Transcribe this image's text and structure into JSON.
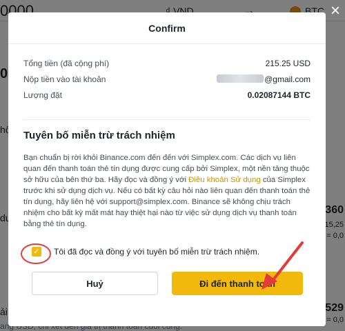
{
  "background": {
    "amount": "0000",
    "fiat_currency": "VND",
    "crypto_currency": "BTC",
    "arrow": "→",
    "left_fragments": [
      "0",
      "hô",
      "du",
      "ải"
    ],
    "right_fragments": [
      "360",
      "215,25",
      "0 = 0,0",
      "529",
      "0 = 0,0"
    ],
    "footer_text": "ang USD, chỉ xét đến giá trị thanh toán cuối cùng."
  },
  "modal": {
    "title": "Confirm",
    "close_icon": "×",
    "info_rows": [
      {
        "label": "Tổng tiền (đã cộng phí)",
        "value": "215.25 USD"
      },
      {
        "label": "Nộp tiền vào tài khoản",
        "value": "@gmail.com"
      },
      {
        "label": "Lượng đặt",
        "value": "0.02087144 BTC"
      }
    ],
    "disclaimer": {
      "title": "Tuyên bố miễn trừ trách nhiệm",
      "text_before_link": "Bạn chuẩn bị rời khỏi Binance.com đến đến với Simplex.com. Các dịch vụ liên quan đến thanh toán thẻ tín dụng được cung cấp bởi Simplex, một nền tảng thuộc sở hữu của bên thứ ba. Hãy đọc và đồng ý với ",
      "link_text": "Điều khoản Sử dụng",
      "text_after_link": " của Simplex trước khi sử dụng dịch vụ. Nếu có bất kỳ câu hỏi nào liên quan đến thanh toán thẻ tín dụng, hãy liên hệ với support@simplex.com. Binance sẽ không chịu trách nhiệm cho bất kỳ mất mát hay thiệt hại nào từ việc sử dụng dịch vụ thanh toán bằng thẻ tín dụng."
    },
    "agree_checkbox": {
      "checked": true,
      "check_glyph": "✓",
      "label": "Tôi đã đọc và đồng ý với tuyên bố miễn trừ trách nhiệm."
    },
    "cancel_label": "Huỷ",
    "continue_label": "Đi đến thanh toán"
  },
  "colors": {
    "accent": "#f0b90b",
    "link": "#c99400",
    "annotation": "#e53a3a"
  }
}
